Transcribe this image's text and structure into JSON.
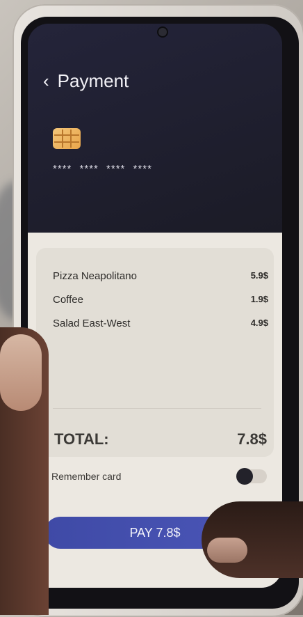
{
  "header": {
    "back_icon": "chevron-left",
    "title": "Payment"
  },
  "card": {
    "chip_icon": "card-chip",
    "number_masked": "**** **** **** ****"
  },
  "order": {
    "items": [
      {
        "name": "Pizza Neapolitano",
        "price": "5.9$"
      },
      {
        "name": "Coffee",
        "price": "1.9$"
      },
      {
        "name": "Salad East-West",
        "price": "4.9$"
      }
    ],
    "total_label": "TOTAL:",
    "total_value": "7.8$"
  },
  "remember": {
    "label": "Remember card",
    "enabled": false
  },
  "pay_button": {
    "label": "PAY 7.8$"
  },
  "colors": {
    "header_bg": "#1d1c27",
    "sheet_bg": "#ece8e1",
    "accent": "#4450b0",
    "chip": "#eeb35f"
  }
}
